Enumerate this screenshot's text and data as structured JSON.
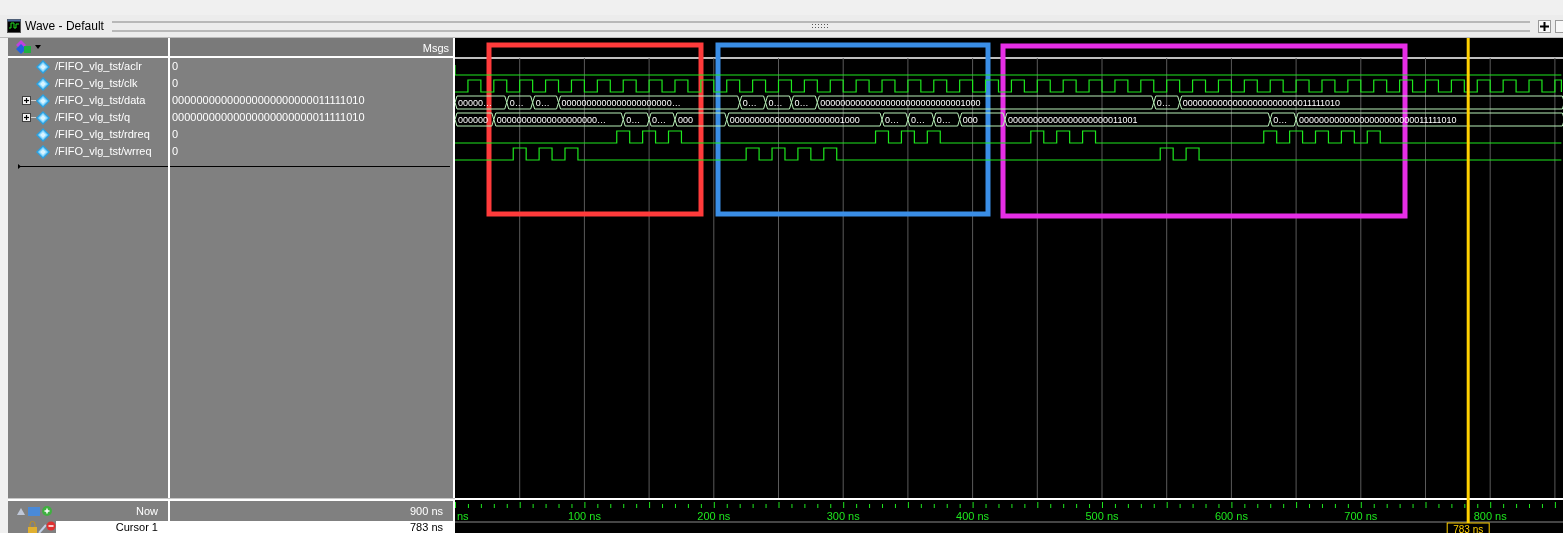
{
  "window": {
    "title": "Wave - Default"
  },
  "header": {
    "values_column": "Msgs"
  },
  "signals": [
    {
      "name": "/FIFO_vlg_tst/aclr",
      "value": "0",
      "kind": "bit"
    },
    {
      "name": "/FIFO_vlg_tst/clk",
      "value": "0",
      "kind": "clock"
    },
    {
      "name": "/FIFO_vlg_tst/data",
      "value": "00000000000000000000000011111010",
      "kind": "bus",
      "expanded": false,
      "segments": [
        "00000…",
        "0…",
        "0…",
        "0000000000000000000000…",
        "0…",
        "0…",
        "0…",
        "00000000000000000000000000001000",
        "0…",
        "00000000000000000000000011111010"
      ]
    },
    {
      "name": "/FIFO_vlg_tst/q",
      "value": "00000000000000000000000011111010",
      "kind": "bus",
      "expanded": false,
      "segments": [
        "000000",
        "00000000000000000000…",
        "0…",
        "0…",
        "000",
        "00000000000000000000001000",
        "0…",
        "0…",
        "0…",
        "000",
        "00000000000000000000011001",
        "0…",
        "00000000000000000000000011111010"
      ]
    },
    {
      "name": "/FIFO_vlg_tst/rdreq",
      "value": "0",
      "kind": "bit"
    },
    {
      "name": "/FIFO_vlg_tst/wrreq",
      "value": "0",
      "kind": "bit"
    }
  ],
  "now": {
    "label": "Now",
    "value": "900 ns"
  },
  "cursor": {
    "label": "Cursor 1",
    "value": "783 ns",
    "marker": "783 ns"
  },
  "time_axis": {
    "labels": [
      "ns",
      "100 ns",
      "200 ns",
      "300 ns",
      "400 ns",
      "500 ns",
      "600 ns",
      "700 ns",
      "800 ns"
    ]
  },
  "highlight_boxes": [
    {
      "color": "#ff3b3b"
    },
    {
      "color": "#3a8ee6"
    },
    {
      "color": "#e62ee6"
    }
  ]
}
